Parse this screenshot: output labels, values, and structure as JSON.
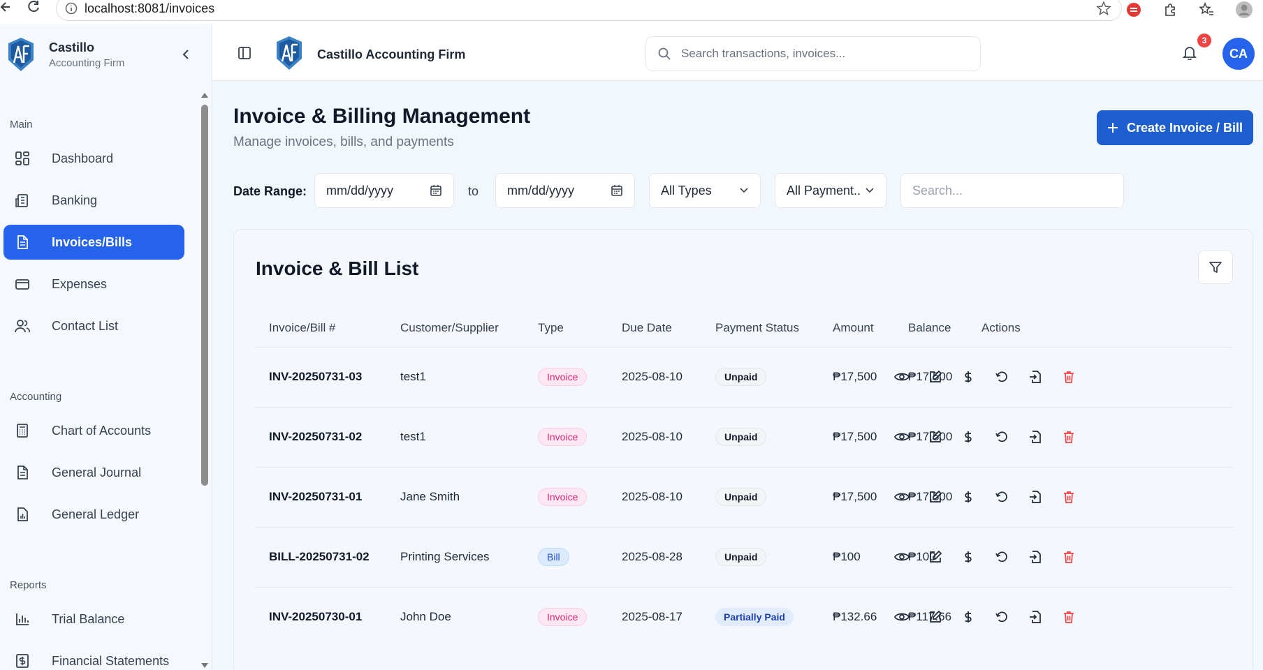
{
  "browser": {
    "url": "localhost:8081/invoices"
  },
  "sidebar": {
    "brand_name": "Castillo",
    "brand_sub": "Accounting Firm",
    "sections": {
      "main": "Main",
      "accounting": "Accounting",
      "reports": "Reports"
    },
    "items": [
      {
        "label": "Dashboard",
        "icon": "dashboard-icon"
      },
      {
        "label": "Banking",
        "icon": "bank-icon"
      },
      {
        "label": "Invoices/Bills",
        "icon": "document-icon",
        "active": true
      },
      {
        "label": "Expenses",
        "icon": "card-icon"
      },
      {
        "label": "Contact List",
        "icon": "users-icon"
      },
      {
        "label": "Chart of Accounts",
        "icon": "calculator-icon"
      },
      {
        "label": "General Journal",
        "icon": "document-icon"
      },
      {
        "label": "General Ledger",
        "icon": "ledger-icon"
      },
      {
        "label": "Trial Balance",
        "icon": "bar-chart-icon"
      },
      {
        "label": "Financial Statements",
        "icon": "dollar-doc-icon"
      }
    ]
  },
  "topbar": {
    "title": "Castillo Accounting Firm",
    "search_placeholder": "Search transactions, invoices...",
    "notification_count": "3",
    "avatar_initials": "CA"
  },
  "page": {
    "title": "Invoice & Billing Management",
    "subtitle": "Manage invoices, bills, and payments",
    "create_button": "Create Invoice / Bill"
  },
  "filters": {
    "date_range_label": "Date Range:",
    "from_placeholder": "mm/dd/yyyy",
    "to_label": "to",
    "to_placeholder": "mm/dd/yyyy",
    "type_select": "All Types",
    "payment_select": "All Payment..",
    "search_placeholder": "Search..."
  },
  "list": {
    "title": "Invoice & Bill List",
    "columns": [
      "Invoice/Bill #",
      "Customer/Supplier",
      "Type",
      "Due Date",
      "Payment Status",
      "Amount",
      "Balance",
      "Actions"
    ],
    "rows": [
      {
        "number": "INV-20250731-03",
        "party": "test1",
        "type": "Invoice",
        "due": "2025-08-10",
        "status": "Unpaid",
        "amount": "₱17,500",
        "balance": "₱17,500"
      },
      {
        "number": "INV-20250731-02",
        "party": "test1",
        "type": "Invoice",
        "due": "2025-08-10",
        "status": "Unpaid",
        "amount": "₱17,500",
        "balance": "₱17,500"
      },
      {
        "number": "INV-20250731-01",
        "party": "Jane Smith",
        "type": "Invoice",
        "due": "2025-08-10",
        "status": "Unpaid",
        "amount": "₱17,500",
        "balance": "₱17,500"
      },
      {
        "number": "BILL-20250731-02",
        "party": "Printing Services",
        "type": "Bill",
        "due": "2025-08-28",
        "status": "Unpaid",
        "amount": "₱100",
        "balance": "₱100"
      },
      {
        "number": "INV-20250730-01",
        "party": "John Doe",
        "type": "Invoice",
        "due": "2025-08-17",
        "status": "Partially Paid",
        "amount": "₱132.66",
        "balance": "₱117.66"
      }
    ]
  },
  "colors": {
    "accent": "#2563eb",
    "invoice_pill": "#db2777",
    "bill_pill": "#1d4ed8",
    "delete": "#ef4444"
  }
}
